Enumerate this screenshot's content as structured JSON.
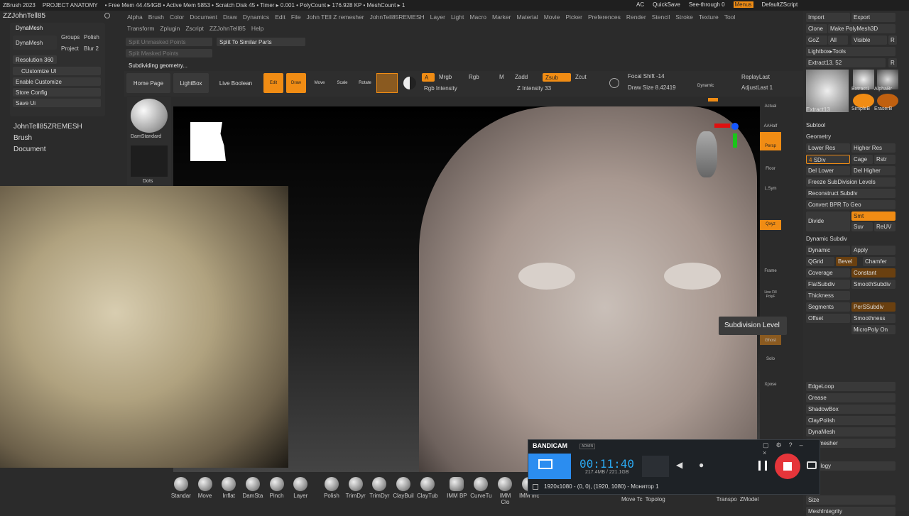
{
  "topbar": {
    "items": [
      "ZBrush 2023",
      "PROJECT ANATOMY",
      "• Free Mem 44.454GB • Active Mem 5853 • Scratch Disk 45 • Timer ▸ 0.001 • PolyCount ▸ 176.928 KP • MeshCount ▸ 1"
    ],
    "right": [
      "AC",
      "QuickSave",
      "See-through  0",
      "Menus",
      "DefaultZScript"
    ]
  },
  "menu1": [
    "Alpha",
    "Brush",
    "Color",
    "Document",
    "Draw",
    "Dynamics",
    "Edit",
    "File",
    "John TEll Z remesher",
    "JohnTell85REMESH",
    "Layer",
    "Light",
    "Macro",
    "Marker",
    "Material",
    "Movie",
    "Picker",
    "Preferences",
    "Render",
    "Stencil",
    "Stroke",
    "Texture",
    "Tool"
  ],
  "menu2": [
    "Transform",
    "Zplugin",
    "Zscript",
    "ZZJohnTell85",
    "Help"
  ],
  "left": {
    "user": "ZZJohnTell85",
    "dynamesh": "DynaMesh",
    "groups": "Groups",
    "polish": "Polish",
    "dyn2": "DynaMesh",
    "project": "Project",
    "blur": "Blur 2",
    "resolution": "Resolution 360",
    "customize": "CUstomize UI",
    "enable": "Enable Customize",
    "store": "Store Config",
    "save": "Save Ui",
    "remesh": "JohnTell85ZREMESH",
    "brush": "Brush",
    "document": "Document"
  },
  "toolbar": {
    "split1": "Split Unmasked Points",
    "split2": "Split Masked Points",
    "splitsimilar": "Split To Similar Parts",
    "status": "Subdividing geometry...",
    "home": "Home Page",
    "lightbox": "LightBox",
    "boolean": "Live Boolean",
    "edit": "Edit",
    "draw": "Draw",
    "move": "Move",
    "scale": "Scale",
    "rotate": "Rotate",
    "a": "A",
    "mrgb": "Mrgb",
    "rgb": "Rgb",
    "m": "M",
    "zadd": "Zadd",
    "zsub": "Zsub",
    "zcut": "Zcut",
    "rgbint": "Rgb Intensity",
    "zint": "Z Intensity 33",
    "focal": "Focal Shift -14",
    "drawsize": "Draw Size 8.42419",
    "dynamic": "Dynamic",
    "replay": "ReplayLast",
    "adjust": "AdjustLast 1"
  },
  "brushes": {
    "dam": "DamStandard",
    "dots": "Dots"
  },
  "shelf": [
    "Actual",
    "AAHalf",
    "Persp",
    "Floor",
    "L.Sym",
    "",
    "Qxyz",
    "",
    "",
    "Frame",
    "Line Fill PolyF",
    "Transp",
    "Ghost",
    "Dynamic",
    "Solo",
    "Xpose"
  ],
  "right": {
    "import": "Import",
    "export": "Export",
    "clone": "Clone",
    "make": "Make PolyMesh3D",
    "goz": "GoZ",
    "all": "All",
    "visible": "Visible",
    "r": "R",
    "lbtools": "Lightbox▸Tools",
    "extract": "Extract13. 52",
    "t1": "Extract13",
    "t2": "Extract1",
    "t3": "AlphaBr",
    "t4": "SimpleB",
    "t5": "EraserB",
    "subtool": "Subtool",
    "geometry": "Geometry",
    "lower": "Lower Res",
    "higher": "Higher Res",
    "sdiv": "SDiv",
    "sdivnum": "4",
    "cage": "Cage",
    "rstr": "Rstr",
    "dellower": "Del Lower",
    "delhigher": "Del Higher",
    "freeze": "Freeze SubDivision Levels",
    "recon": "Reconstruct Subdiv",
    "convert": "Convert BPR To Geo",
    "divide": "Divide",
    "smt": "Smt",
    "suv": "Suv",
    "reuv": "ReUV",
    "dynsub": "Dynamic Subdiv",
    "dynamic": "Dynamic",
    "apply": "Apply",
    "qgrid": "QGrid",
    "bevel": "Bevel",
    "chamfer": "Chamfer",
    "coverage": "Coverage",
    "constant": "Constant",
    "flat": "FlatSubdiv",
    "smooth": "SmoothSubdiv",
    "thick": "Thickness",
    "segments": "Segments",
    "perssub": "PerSSubdiv",
    "offset": "Offset",
    "smoothness": "Smoothness",
    "micro": "MicroPoly On",
    "edgeloop": "EdgeLoop",
    "crease": "Crease",
    "shadow": "ShadowBox",
    "clay": "ClayPolish",
    "dyna": "DynaMesh",
    "zremesh": "ZRemesher",
    "topology": "Topology",
    "size": "Size",
    "mesh": "MeshIntegrity"
  },
  "tooltip": "Subdivision Level",
  "bottom": [
    "Standar",
    "Move",
    "Inflat",
    "DamSta",
    "Pinch",
    "Layer",
    "Polish",
    "TrimDyr",
    "TrimDyr",
    "ClayBuil",
    "ClayTub",
    "IMM BP",
    "CurveTu",
    "IMM Clo",
    "IMM Inc"
  ],
  "bottom2": [
    "Move Tc",
    "Topolog",
    "Transpo",
    "ZModel"
  ],
  "bandicam": {
    "brand": "BANDICAM",
    "admin": "ADMIN",
    "time": "00:11:40",
    "size": "217.4MB / 221.1GB",
    "res": "1920x1080 - (0, 0), (1920, 1080) - Монитор 1"
  }
}
